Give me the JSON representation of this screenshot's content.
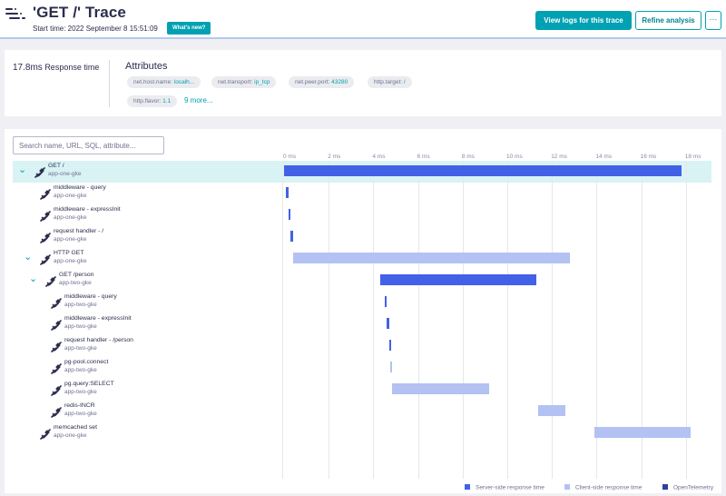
{
  "header": {
    "title": "'GET /' Trace",
    "start_time": "Start time: 2022 September 8 15:51:09",
    "whats_new": "What's new?",
    "view_logs": "View logs for this trace",
    "refine": "Refine analysis",
    "more": "···"
  },
  "summary": {
    "response_value": "17.8ms",
    "response_label": "Response time",
    "attributes_title": "Attributes",
    "chips": [
      {
        "key": "net.host.name:",
        "value": "localh..."
      },
      {
        "key": "net.transport:",
        "value": "ip_tcp"
      },
      {
        "key": "net.peer.port:",
        "value": "43280"
      },
      {
        "key": "http.target:",
        "value": "/"
      },
      {
        "key": "http.flavor:",
        "value": "1.1"
      }
    ],
    "more_link": "9 more..."
  },
  "waterfall": {
    "search_placeholder": "Search name, URL, SQL, attribute...",
    "axis_labels": [
      "0 ms",
      "2 ms",
      "4 ms",
      "6 ms",
      "8 ms",
      "10 ms",
      "12 ms",
      "14 ms",
      "16 ms",
      "18 ms"
    ],
    "spans": [
      {
        "name": "GET /",
        "service": "app-one-gke",
        "depth": 0,
        "expandable": true,
        "type": "server",
        "start_ms": 0,
        "end_ms": 17.8,
        "selected": true
      },
      {
        "name": "middleware - query",
        "service": "app-one-gke",
        "depth": 1,
        "expandable": false,
        "type": "server",
        "start_ms": 0.1,
        "end_ms": 0.2
      },
      {
        "name": "middleware - expressInit",
        "service": "app-one-gke",
        "depth": 1,
        "expandable": false,
        "type": "server",
        "start_ms": 0.2,
        "end_ms": 0.3
      },
      {
        "name": "request handler - /",
        "service": "app-one-gke",
        "depth": 1,
        "expandable": false,
        "type": "server",
        "start_ms": 0.3,
        "end_ms": 0.4
      },
      {
        "name": "HTTP GET",
        "service": "app-one-gke",
        "depth": 1,
        "expandable": true,
        "type": "client",
        "start_ms": 0.4,
        "end_ms": 12.8
      },
      {
        "name": "GET /person",
        "service": "app-two-gke",
        "depth": 2,
        "expandable": true,
        "type": "server",
        "start_ms": 4.3,
        "end_ms": 11.3
      },
      {
        "name": "middleware - query",
        "service": "app-two-gke",
        "depth": 3,
        "expandable": false,
        "type": "server",
        "start_ms": 4.5,
        "end_ms": 4.6
      },
      {
        "name": "middleware - expressInit",
        "service": "app-two-gke",
        "depth": 3,
        "expandable": false,
        "type": "server",
        "start_ms": 4.6,
        "end_ms": 4.7
      },
      {
        "name": "request handler - /person",
        "service": "app-two-gke",
        "depth": 3,
        "expandable": false,
        "type": "server",
        "start_ms": 4.7,
        "end_ms": 4.8
      },
      {
        "name": "pg-pool.connect",
        "service": "app-two-gke",
        "depth": 3,
        "expandable": false,
        "type": "client",
        "start_ms": 4.75,
        "end_ms": 4.85
      },
      {
        "name": "pg.query:SELECT",
        "service": "app-two-gke",
        "depth": 3,
        "expandable": false,
        "type": "client",
        "start_ms": 4.85,
        "end_ms": 9.2
      },
      {
        "name": "redis-INCR",
        "service": "app-two-gke",
        "depth": 3,
        "expandable": false,
        "type": "client",
        "start_ms": 11.4,
        "end_ms": 12.6
      },
      {
        "name": "memcached set",
        "service": "app-one-gke",
        "depth": 1,
        "expandable": false,
        "type": "client",
        "start_ms": 13.9,
        "end_ms": 18.2
      }
    ]
  },
  "legend": [
    {
      "label": "Server-side response time",
      "color": "#4361e6"
    },
    {
      "label": "Client-side response time",
      "color": "#b3c1f3"
    },
    {
      "label": "OpenTelemetry",
      "color": "#2c3fa8"
    }
  ],
  "colors": {
    "accent": "#00a1b2",
    "server": "#4361e6",
    "client": "#b3c1f3",
    "selected_row": "#d9f3f5"
  }
}
